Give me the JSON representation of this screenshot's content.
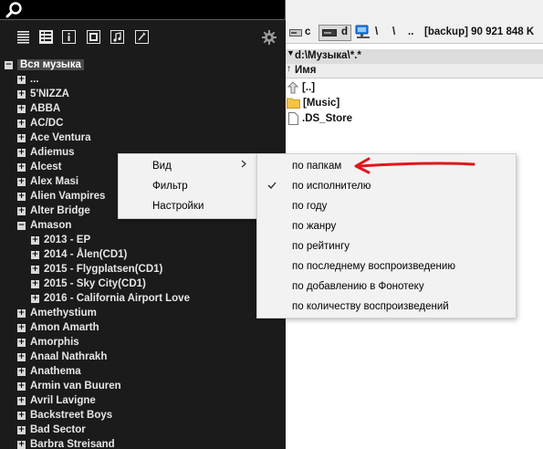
{
  "library": {
    "root_label": "Вся музыка",
    "artists": [
      "...",
      "5'NIZZA",
      "ABBA",
      "AC/DC",
      "Ace Ventura",
      "Adiemus",
      "Alcest",
      "Alex Masi",
      "Alien Vampires",
      "Alter Bridge",
      "Amason"
    ],
    "amason_albums": [
      "2013 - EP",
      "2014 - Ålen(CD1)",
      "2015 - Flygplatsen(CD1)",
      "2015 - Sky City(CD1)",
      "2016 - California Airport Love"
    ],
    "artists_after": [
      "Amethystium",
      "Amon Amarth",
      "Amorphis",
      "Anaal Nathrakh",
      "Anathema",
      "Armin van Buuren",
      "Avril Lavigne",
      "Backstreet Boys",
      "Bad Sector",
      "Barbra Streisand"
    ]
  },
  "file_panel": {
    "drive_c": "c",
    "drive_d": "d",
    "sep1": "\\",
    "sep2": "\\",
    "dotdot": "..",
    "backup_info": "[backup]  90 921 848 K",
    "path": "d:\\Музыка\\*.*",
    "column_name": "Имя",
    "rows": [
      "[..]",
      "[Music]",
      ".DS_Store"
    ]
  },
  "context_menu": {
    "items": [
      "Вид",
      "Фильтр",
      "Настройки"
    ],
    "arrow": "›"
  },
  "submenu": {
    "items": [
      "по папкам",
      "по исполнителю",
      "по году",
      "по жанру",
      "по рейтингу",
      "по последнему воспроизведению",
      "по добавлению в Фонотеку",
      "по количеству воспроизведений"
    ],
    "checked_item": "по исполнителю"
  },
  "colors": {
    "dark_panel": "#1b1b1b",
    "annotation_arrow": "#e0161b"
  },
  "icons": [
    "search-icon",
    "list-view-icon",
    "detail-view-icon",
    "info-icon",
    "image-icon",
    "music-file-icon",
    "gear-icon",
    "drive-icon",
    "network-drive-icon",
    "folder-up-icon",
    "folder-icon",
    "file-icon",
    "checkmark-icon",
    "submenu-arrow-icon"
  ]
}
